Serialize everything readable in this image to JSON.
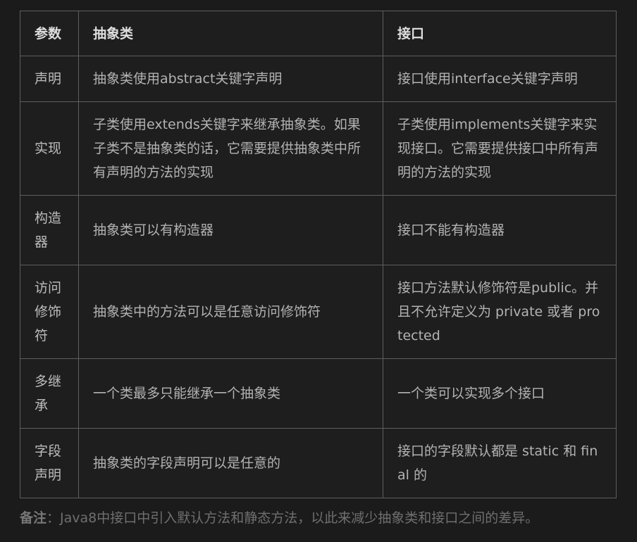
{
  "table": {
    "headers": [
      "参数",
      "抽象类",
      "接口"
    ],
    "rows": [
      [
        "声明",
        "抽象类使用abstract关键字声明",
        "接口使用interface关键字声明"
      ],
      [
        "实现",
        "子类使用extends关键字来继承抽象类。如果子类不是抽象类的话，它需要提供抽象类中所有声明的方法的实现",
        "子类使用implements关键字来实现接口。它需要提供接口中所有声明的方法的实现"
      ],
      [
        "构造器",
        "抽象类可以有构造器",
        "接口不能有构造器"
      ],
      [
        "访问修饰符",
        "抽象类中的方法可以是任意访问修饰符",
        "接口方法默认修饰符是public。并且不允许定义为 private 或者 protected"
      ],
      [
        "多继承",
        "一个类最多只能继承一个抽象类",
        "一个类可以实现多个接口"
      ],
      [
        "字段声明",
        "抽象类的字段声明可以是任意的",
        "接口的字段默认都是 static 和 final 的"
      ]
    ]
  },
  "note": {
    "label": "备注",
    "text": "：Java8中接口中引入默认方法和静态方法，以此来减少抽象类和接口之间的差异。"
  }
}
